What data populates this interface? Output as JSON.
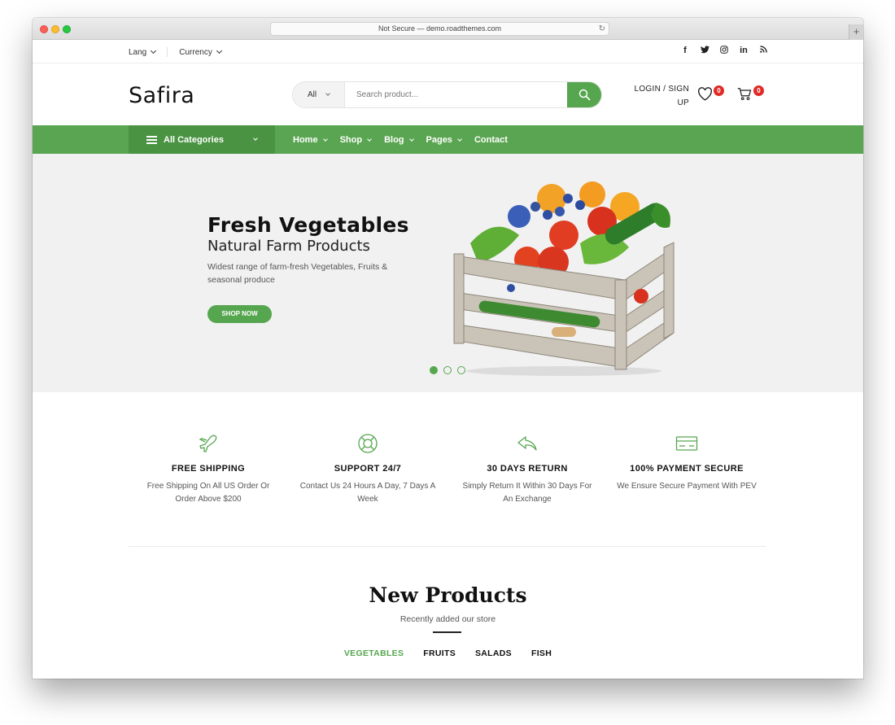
{
  "browser": {
    "url": "Not Secure — demo.roadthemes.com",
    "newtab_label": "+"
  },
  "topbar": {
    "lang": "Lang",
    "currency": "Currency",
    "social": [
      "facebook-icon",
      "twitter-icon",
      "instagram-icon",
      "linkedin-icon",
      "rss-icon"
    ]
  },
  "header": {
    "logo": "Safira",
    "search_category": "All",
    "search_placeholder": "Search product...",
    "account_line1": "LOGIN / SIGN",
    "account_line2": "UP",
    "wishlist_count": "0",
    "cart_count": "0"
  },
  "nav": {
    "all_categories": "All Categories",
    "items": [
      {
        "label": "Home",
        "dropdown": true
      },
      {
        "label": "Shop",
        "dropdown": true
      },
      {
        "label": "Blog",
        "dropdown": true
      },
      {
        "label": "Pages",
        "dropdown": true
      },
      {
        "label": "Contact",
        "dropdown": false
      }
    ]
  },
  "hero": {
    "title": "Fresh Vegetables",
    "subtitle": "Natural Farm Products",
    "description": "Widest range of farm-fresh Vegetables, Fruits & seasonal produce",
    "button": "SHOP NOW",
    "slides_total": 3,
    "slide_active": 1
  },
  "features": [
    {
      "icon": "airplane-icon",
      "title": "FREE SHIPPING",
      "desc": "Free Shipping On All US Order Or Order Above $200"
    },
    {
      "icon": "lifebuoy-icon",
      "title": "SUPPORT 24/7",
      "desc": "Contact Us 24 Hours A Day, 7 Days A Week"
    },
    {
      "icon": "return-arrow-icon",
      "title": "30 DAYS RETURN",
      "desc": "Simply Return It Within 30 Days For An Exchange"
    },
    {
      "icon": "credit-card-icon",
      "title": "100% PAYMENT SECURE",
      "desc": "We Ensure Secure Payment With PEV"
    }
  ],
  "new_products": {
    "title": "New Products",
    "subtitle": "Recently added our store",
    "tabs": [
      "VEGETABLES",
      "FRUITS",
      "SALADS",
      "FISH"
    ],
    "active_tab": "VEGETABLES"
  },
  "colors": {
    "brand_green": "#56a64f",
    "nav_green": "#5aa551",
    "badge_red": "#e02b27"
  }
}
